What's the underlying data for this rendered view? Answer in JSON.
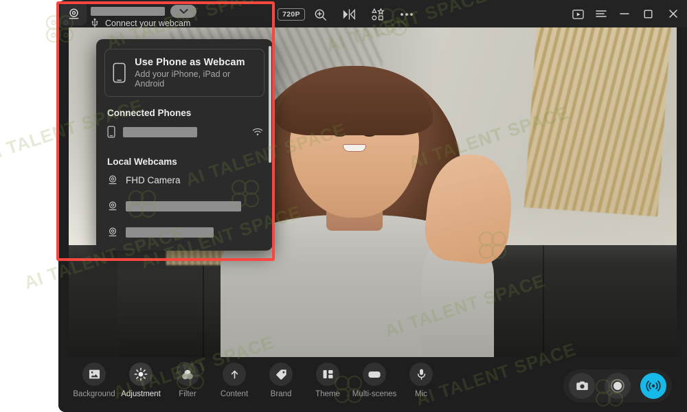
{
  "app": {
    "window_title": "Webcam App",
    "titlebar": {
      "webcam_tab_icon": "webcam-icon",
      "device_name_redacted": "",
      "dropdown_chevron_icon": "chevron-down-icon",
      "connect_icon": "usb-icon",
      "connect_label": "Connect your webcam"
    },
    "center_tools": [
      {
        "name": "resolution-badge",
        "label": "720P",
        "icon": ""
      },
      {
        "name": "zoom-in-button",
        "label": "",
        "icon": "zoom-in-icon"
      },
      {
        "name": "mirror-button",
        "label": "",
        "icon": "mirror-flip-icon"
      },
      {
        "name": "shapes-button",
        "label": "",
        "icon": "shapes-icon"
      },
      {
        "name": "more-button",
        "label": "",
        "icon": "more-horizontal-icon"
      }
    ],
    "window_controls": [
      {
        "name": "media-library-button",
        "icon": "video-folder-icon"
      },
      {
        "name": "menu-button",
        "icon": "hamburger-menu-icon"
      },
      {
        "name": "minimize-button",
        "icon": "minimize-icon"
      },
      {
        "name": "maximize-button",
        "icon": "maximize-icon"
      },
      {
        "name": "close-button",
        "icon": "close-icon"
      }
    ]
  },
  "dropdown": {
    "use_phone": {
      "icon": "phone-icon",
      "title": "Use Phone as Webcam",
      "subtitle": "Add your iPhone, iPad or Android"
    },
    "connected_phones": {
      "heading": "Connected Phones",
      "items": [
        {
          "icon": "phone-icon",
          "label": "",
          "redacted": true,
          "status_icon": "wifi-icon"
        }
      ]
    },
    "local_webcams": {
      "heading": "Local Webcams",
      "items": [
        {
          "icon": "webcam-icon",
          "label": "FHD Camera",
          "redacted": false
        },
        {
          "icon": "webcam-icon",
          "label": "",
          "redacted": true
        },
        {
          "icon": "webcam-icon",
          "label": "",
          "redacted": true
        }
      ]
    },
    "scrollbar_visible": true
  },
  "bottom_toolbar": {
    "items": [
      {
        "label": "Background",
        "icon": "image-icon",
        "active": false
      },
      {
        "label": "Adjustment",
        "icon": "brightness-icon",
        "active": true
      },
      {
        "label": "Filter",
        "icon": "filter-circles-icon",
        "active": false
      },
      {
        "label": "Content",
        "icon": "upload-arrow-icon",
        "active": false
      },
      {
        "label": "Brand",
        "icon": "tag-icon",
        "active": false
      },
      {
        "label": "Theme",
        "icon": "layout-blocks-icon",
        "active": false
      },
      {
        "label": "Multi-scenes",
        "icon": "scenes-icon",
        "active": false
      },
      {
        "label": "Mic",
        "icon": "microphone-icon",
        "active": false
      }
    ],
    "actions": [
      {
        "name": "snapshot-button",
        "icon": "camera-icon",
        "accent": ""
      },
      {
        "name": "record-button",
        "icon": "record-icon",
        "accent": ""
      },
      {
        "name": "live-button",
        "icon": "broadcast-icon",
        "accent": "#17B9E8"
      }
    ]
  },
  "annotation": {
    "rectangle_color": "#F9473F",
    "shape": "rectangle"
  },
  "watermarks": {
    "text": "AI TALENT SPACE",
    "color": "#78963C"
  },
  "colors": {
    "window_bg": "#1E1E1E",
    "titlebar_bg": "#232323",
    "panel_bg": "#2B2B2B",
    "accent_live": "#17B9E8",
    "annotation_red": "#F9473F",
    "page_bg": "#FFFFFF"
  }
}
